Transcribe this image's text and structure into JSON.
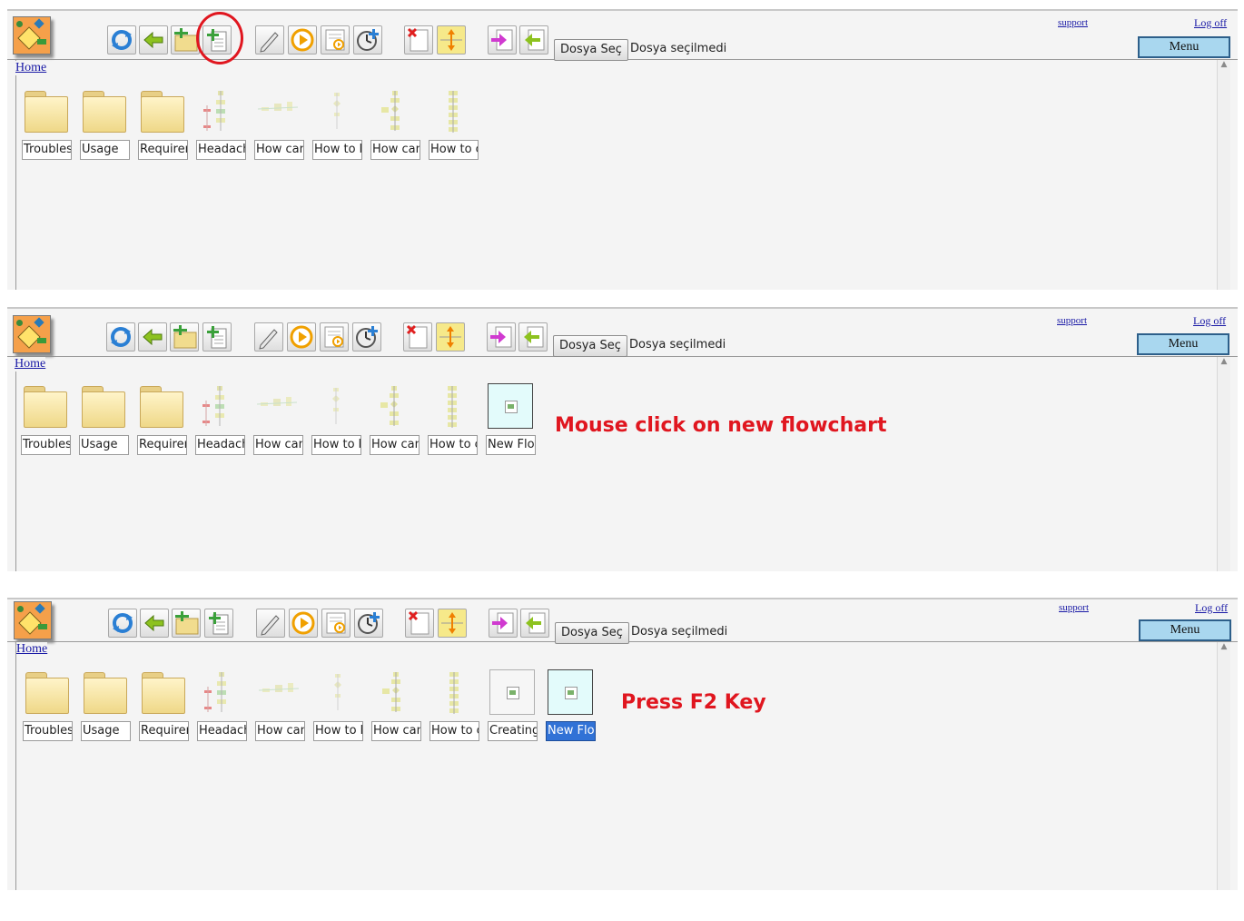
{
  "panels": [
    {
      "file_button": "Dosya Seç",
      "file_status": "Dosya seçilmedi",
      "support": "support",
      "logoff": "Log off",
      "menu": "Menu",
      "home": "Home",
      "items": [
        "Troubles",
        "Usage",
        "Requiren",
        "Headach",
        "How can",
        "How to b",
        "How can",
        "How to c"
      ],
      "annotation": ""
    },
    {
      "file_button": "Dosya Seç",
      "file_status": "Dosya seçilmedi",
      "support": "support",
      "logoff": "Log off",
      "menu": "Menu",
      "home": "Home",
      "items": [
        "Troubles",
        "Usage",
        "Requiren",
        "Headach",
        "How can",
        "How to b",
        "How can",
        "How to c",
        "New Flov"
      ],
      "annotation": "Mouse click on new flowchart"
    },
    {
      "file_button": "Dosya Seç",
      "file_status": "Dosya seçilmedi",
      "support": "support",
      "logoff": "Log off",
      "menu": "Menu",
      "home": "Home",
      "items": [
        "Troubles",
        "Usage",
        "Requiren",
        "Headach",
        "How can",
        "How to b",
        "How can",
        "How to c",
        "Creating",
        "New Flov"
      ],
      "annotation": "Press F2 Key"
    }
  ],
  "toolbar_icons": [
    "refresh-icon",
    "back-arrow-icon",
    "new-folder-icon",
    "new-flowchart-icon",
    "edit-icon",
    "play-icon",
    "run-document-icon",
    "history-clock-icon",
    "delete-icon",
    "resize-icon",
    "import-icon",
    "export-icon"
  ],
  "colors": {
    "annotation": "#e0161f",
    "menu_bg": "#a9d7ef",
    "selection": "#3172d6",
    "panel_bg": "#f4f4f4"
  }
}
